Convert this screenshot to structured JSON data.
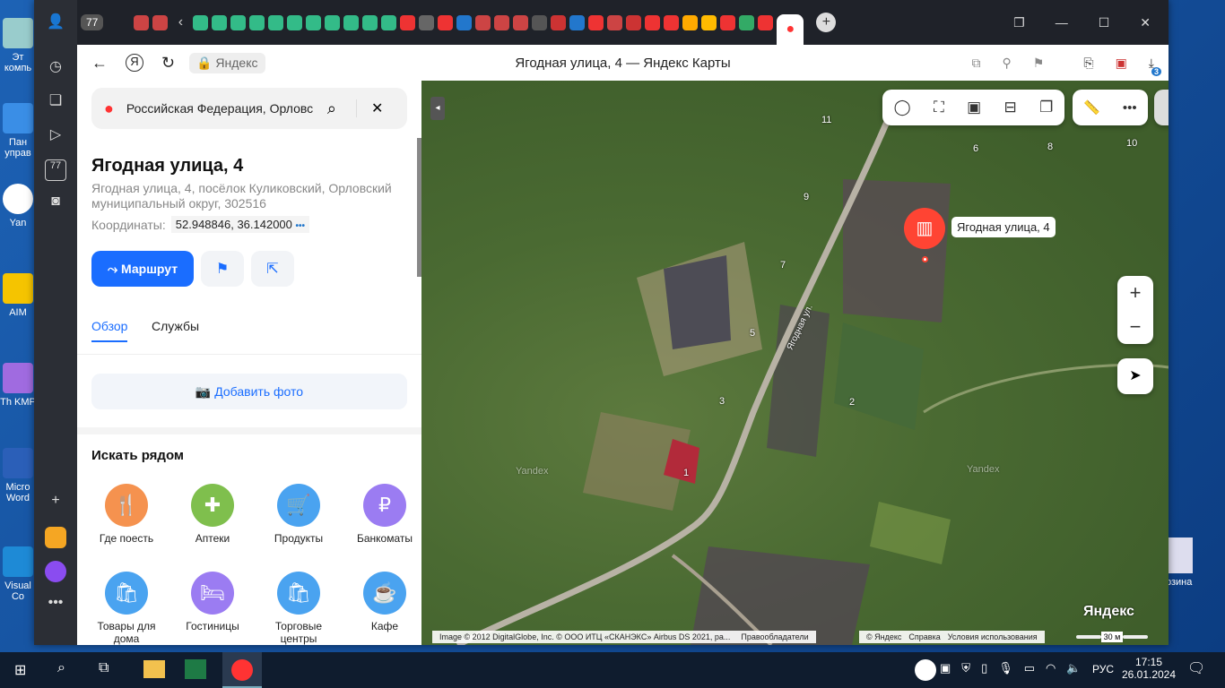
{
  "desktop": {
    "icons": [
      "Эт компь",
      "Пан управ",
      "Yan",
      "AIM",
      "Th KMP",
      "Micro Word",
      "Visual Co"
    ],
    "recycle": "рзина"
  },
  "browser": {
    "tab_count": "77",
    "page_title": "Ягодная улица, 4 — Яндекс Карты",
    "domain": "Яндекс",
    "downloads_badge": "3"
  },
  "search": {
    "value": "Российская Федерация, Орловс"
  },
  "place": {
    "title": "Ягодная улица, 4",
    "address": "Ягодная улица, 4, посёлок Куликовский, Орловский муниципальный округ, 302516",
    "coords_label": "Координаты:",
    "coords": "52.948846, 36.142000",
    "more": "•••"
  },
  "actions": {
    "route": "Маршрут"
  },
  "tabs": [
    "Обзор",
    "Службы"
  ],
  "add_photo": "Добавить фото",
  "nearby": {
    "title": "Искать рядом",
    "items": [
      {
        "label": "Где поесть",
        "icon": "🍴",
        "color": "#f5924f"
      },
      {
        "label": "Аптеки",
        "icon": "✚",
        "color": "#7fbf4d"
      },
      {
        "label": "Продукты",
        "icon": "🛒",
        "color": "#4aa3f0"
      },
      {
        "label": "Банкоматы",
        "icon": "₽",
        "color": "#9b7cf2"
      },
      {
        "label": "Товары для дома",
        "icon": "🛍",
        "color": "#4aa3f0"
      },
      {
        "label": "Гостиницы",
        "icon": "🛏",
        "color": "#9b7cf2"
      },
      {
        "label": "Торговые центры",
        "icon": "🛍",
        "color": "#4aa3f0"
      },
      {
        "label": "Кафе",
        "icon": "☕",
        "color": "#4aa3f0"
      }
    ]
  },
  "map": {
    "marker_label": "Ягодная улица, 4",
    "street": "Ягодная ул.",
    "numbers": [
      "11",
      "6",
      "8",
      "10",
      "9",
      "7",
      "5",
      "2",
      "3",
      "1"
    ],
    "watermark": "Yandex",
    "logo": "Яндекс",
    "attribution": "Image © 2012 DigitalGlobe, Inc. © ООО ИТЦ «СКАНЭКС» Airbus DS 2021, ра...",
    "rights": "Правообладатели",
    "copyright": "© Яндекс",
    "help": "Справка",
    "terms": "Условия использования",
    "scale": "30 м",
    "zoom_in": "+",
    "zoom_out": "−"
  },
  "taskbar": {
    "lang": "РУС",
    "time": "17:15",
    "date": "26.01.2024"
  }
}
